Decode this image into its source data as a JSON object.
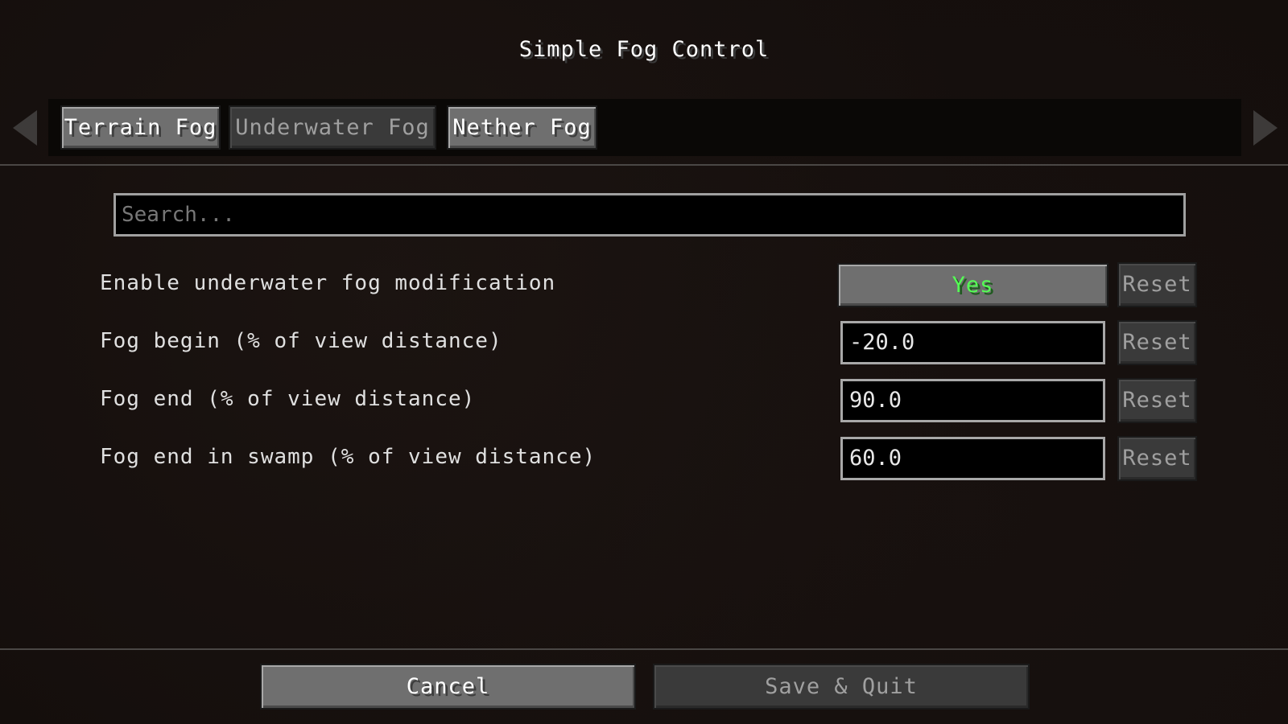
{
  "window": {
    "title": "Simple Fog Control"
  },
  "tabs": [
    {
      "label": "Terrain Fog",
      "state": "enabled"
    },
    {
      "label": "Underwater Fog",
      "state": "selected"
    },
    {
      "label": "Nether Fog",
      "state": "enabled"
    }
  ],
  "search": {
    "placeholder": "Search...",
    "value": ""
  },
  "settings": [
    {
      "label": "Enable underwater fog modification",
      "type": "toggle",
      "value": "Yes",
      "reset_label": "Reset"
    },
    {
      "label": "Fog begin (% of view distance)",
      "type": "number",
      "value": "-20.0",
      "reset_label": "Reset"
    },
    {
      "label": "Fog end (% of view distance)",
      "type": "number",
      "value": "90.0",
      "reset_label": "Reset"
    },
    {
      "label": "Fog end in swamp (% of view distance)",
      "type": "number",
      "value": "60.0",
      "reset_label": "Reset"
    }
  ],
  "footer": {
    "cancel_label": "Cancel",
    "save_label": "Save & Quit"
  },
  "icons": {
    "left_arrow": "chevron-left-icon",
    "right_arrow": "chevron-right-icon"
  },
  "colors": {
    "background": "#140e0c",
    "button": "#6f6f6f",
    "button_disabled": "#3a3a3a",
    "toggle_on": "#55ff55"
  }
}
